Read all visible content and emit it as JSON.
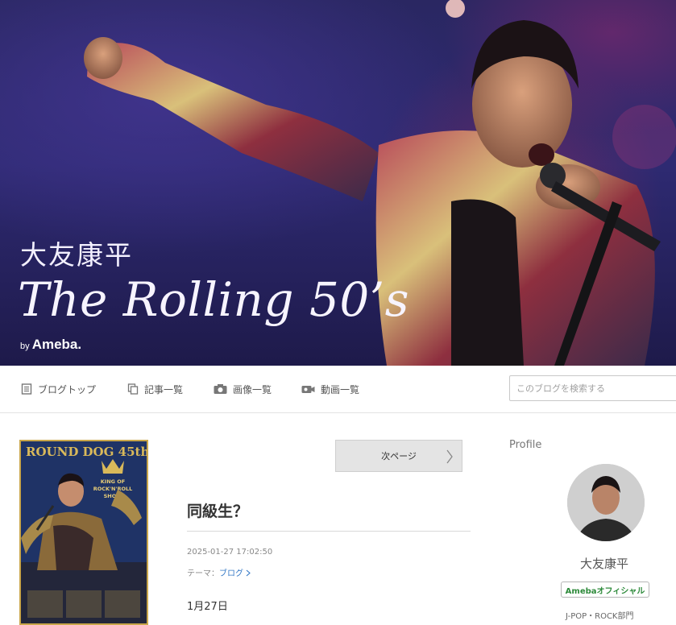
{
  "banner": {
    "name": "大友康平",
    "title": "The Rolling 50’s",
    "by": "by ",
    "brand": "Ameba."
  },
  "nav": {
    "items": [
      {
        "label": "ブログトップ",
        "icon": "document-icon"
      },
      {
        "label": "記事一覧",
        "icon": "copy-icon"
      },
      {
        "label": "画像一覧",
        "icon": "camera-icon"
      },
      {
        "label": "動画一覧",
        "icon": "video-camera-icon"
      }
    ],
    "search_placeholder": "このブログを検索する"
  },
  "poster": {
    "headline": "ROUND DOG 45th",
    "badge_top": "KING OF",
    "badge_mid": "ROCK'N'ROLL",
    "badge_bottom": "SHOW"
  },
  "main": {
    "next_page": "次ページ",
    "post_title": "同級生？",
    "post_date": "2025-01-27 17:02:50",
    "theme_prefix": "テーマ：",
    "theme_link": "ブログ",
    "body_first_line": "1月27日"
  },
  "sidebar": {
    "profile_heading": "Profile",
    "name": "大友康平",
    "official_badge": "Amebaオフィシャル",
    "category": "J-POP・ROCK部門"
  },
  "colors": {
    "banner_bg": "#2e2a72",
    "link": "#3478c6",
    "official_green": "#2d8a3a",
    "poster_border": "#c9a64a"
  }
}
